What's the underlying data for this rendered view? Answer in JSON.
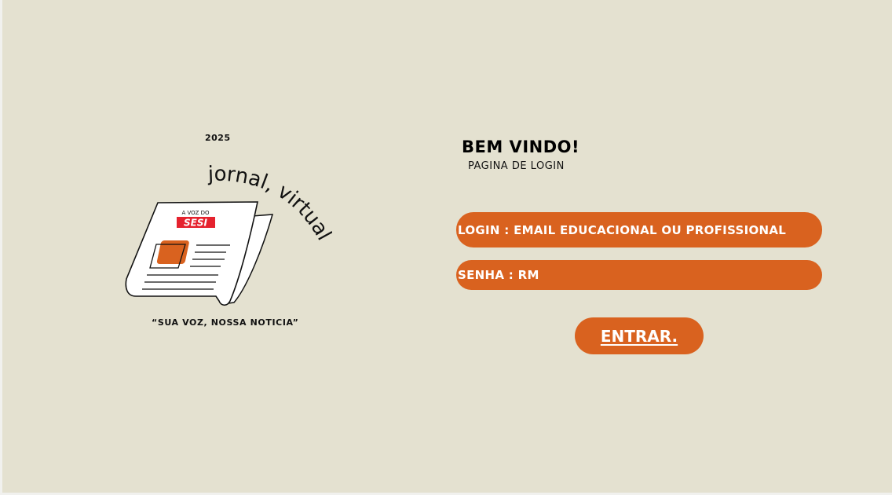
{
  "branding": {
    "year": "2025",
    "arc_text": "jornal, virtual",
    "paper_header_small": "A VOZ DO",
    "paper_header_brand": "SESI",
    "slogan": "“SUA VOZ, NOSSA NOTICIA”"
  },
  "welcome": {
    "title": "BEM VINDO!",
    "subtitle": "PAGINA DE LOGIN"
  },
  "form": {
    "login_label": "LOGIN : EMAIL EDUCACIONAL OU PROFISSIONAL",
    "password_label": "SENHA : RM",
    "submit_label": "ENTRAR."
  },
  "colors": {
    "background": "#e4e1d0",
    "accent": "#d9621f",
    "brand_red": "#e5222e"
  }
}
